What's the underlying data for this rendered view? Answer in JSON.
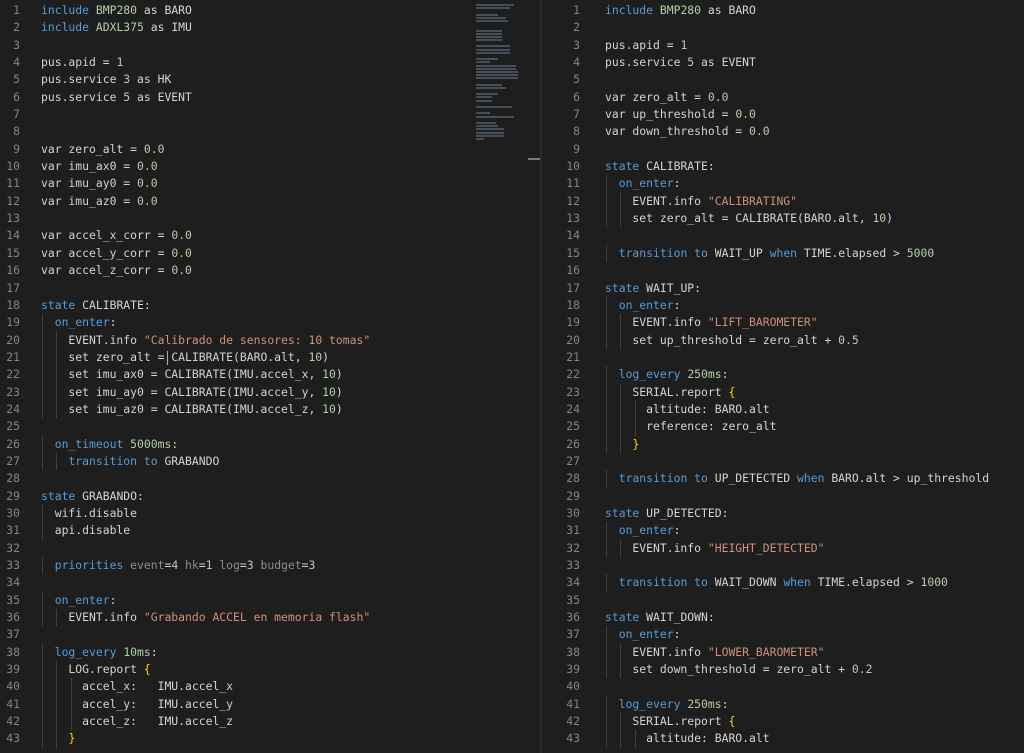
{
  "editor": {
    "left": {
      "lines": [
        {
          "n": "1",
          "html": "<span class='kw'>include</span> <span class='num'>BMP280</span> as BARO"
        },
        {
          "n": "2",
          "html": "<span class='kw'>include</span> <span class='num'>ADXL375</span> as IMU"
        },
        {
          "n": "3",
          "html": ""
        },
        {
          "n": "4",
          "html": "pus.apid = <span class='num'>1</span>"
        },
        {
          "n": "5",
          "html": "pus.service <span class='num'>3</span> as HK"
        },
        {
          "n": "6",
          "html": "pus.service <span class='num'>5</span> as EVENT"
        },
        {
          "n": "7",
          "html": ""
        },
        {
          "n": "8",
          "html": ""
        },
        {
          "n": "9",
          "html": "var zero_alt = <span class='num'>0.0</span>"
        },
        {
          "n": "10",
          "html": "var imu_ax0 = <span class='num'>0.0</span>"
        },
        {
          "n": "11",
          "html": "var imu_ay0 = <span class='num'>0.0</span>"
        },
        {
          "n": "12",
          "html": "var imu_az0 = <span class='num'>0.0</span>"
        },
        {
          "n": "13",
          "html": ""
        },
        {
          "n": "14",
          "html": "var accel_x_corr = <span class='num'>0.0</span>"
        },
        {
          "n": "15",
          "html": "var accel_y_corr = <span class='num'>0.0</span>"
        },
        {
          "n": "16",
          "html": "var accel_z_corr = <span class='num'>0.0</span>"
        },
        {
          "n": "17",
          "html": ""
        },
        {
          "n": "18",
          "html": "<span class='kw'>state</span> CALIBRATE:"
        },
        {
          "n": "19",
          "html": "  <span class='kw'>on_enter</span>:"
        },
        {
          "n": "20",
          "html": "    EVENT.info <span class='str'>\"Calibrado de sensores: 10 tomas\"</span>"
        },
        {
          "n": "21",
          "html": "    set zero_alt = CALIBRATE(BARO.alt, <span class='num'>10</span>)",
          "cursor": true
        },
        {
          "n": "22",
          "html": "    set imu_ax0 = CALIBRATE(IMU.accel_x, <span class='num'>10</span>)"
        },
        {
          "n": "23",
          "html": "    set imu_ay0 = CALIBRATE(IMU.accel_y, <span class='num'>10</span>)"
        },
        {
          "n": "24",
          "html": "    set imu_az0 = CALIBRATE(IMU.accel_z, <span class='num'>10</span>)"
        },
        {
          "n": "25",
          "html": ""
        },
        {
          "n": "26",
          "html": "  <span class='kw'>on_timeout</span> <span class='num'>5000ms</span>:"
        },
        {
          "n": "27",
          "html": "    <span class='kw'>transition</span> <span class='kw'>to</span> GRABANDO"
        },
        {
          "n": "28",
          "html": ""
        },
        {
          "n": "29",
          "html": "<span class='kw'>state</span> GRABANDO:"
        },
        {
          "n": "30",
          "html": "  wifi.disable"
        },
        {
          "n": "31",
          "html": "  api.disable"
        },
        {
          "n": "32",
          "html": ""
        },
        {
          "n": "33",
          "html": "  <span class='kw'>priorities</span> <span class='dim'>event</span>=<span class='num'>4</span> <span class='dim'>hk</span>=<span class='num'>1</span> <span class='dim'>log</span>=<span class='num'>3</span> <span class='dim'>budget</span>=<span class='num'>3</span>"
        },
        {
          "n": "34",
          "html": ""
        },
        {
          "n": "35",
          "html": "  <span class='kw'>on_enter</span>:"
        },
        {
          "n": "36",
          "html": "    EVENT.info <span class='str'>\"Grabando ACCEL en memoria flash\"</span>"
        },
        {
          "n": "37",
          "html": ""
        },
        {
          "n": "38",
          "html": "  <span class='kw'>log_every</span> <span class='num'>10ms</span>:"
        },
        {
          "n": "39",
          "html": "    LOG.report <span class='brace'>{</span>"
        },
        {
          "n": "40",
          "html": "      accel_x:   IMU.accel_x"
        },
        {
          "n": "41",
          "html": "      accel_y:   IMU.accel_y"
        },
        {
          "n": "42",
          "html": "      accel_z:   IMU.accel_z"
        },
        {
          "n": "43",
          "html": "    <span class='brace'>}</span>"
        }
      ]
    },
    "right": {
      "lines": [
        {
          "n": "1",
          "html": "<span class='kw'>include</span> <span class='num'>BMP280</span> as BARO"
        },
        {
          "n": "2",
          "html": ""
        },
        {
          "n": "3",
          "html": "pus.apid = <span class='num'>1</span>"
        },
        {
          "n": "4",
          "html": "pus.service <span class='num'>5</span> as EVENT"
        },
        {
          "n": "5",
          "html": ""
        },
        {
          "n": "6",
          "html": "var zero_alt = <span class='num'>0.0</span>"
        },
        {
          "n": "7",
          "html": "var up_threshold = <span class='num'>0.0</span>"
        },
        {
          "n": "8",
          "html": "var down_threshold = <span class='num'>0.0</span>"
        },
        {
          "n": "9",
          "html": ""
        },
        {
          "n": "10",
          "html": "<span class='kw'>state</span> CALIBRATE:"
        },
        {
          "n": "11",
          "html": "  <span class='kw'>on_enter</span>:"
        },
        {
          "n": "12",
          "html": "    EVENT.info <span class='str'>\"CALIBRATING\"</span>"
        },
        {
          "n": "13",
          "html": "    set zero_alt = CALIBRATE(BARO.alt, <span class='num'>10</span>)"
        },
        {
          "n": "14",
          "html": ""
        },
        {
          "n": "15",
          "html": "  <span class='kw'>transition</span> <span class='kw'>to</span> WAIT_UP <span class='kw'>when</span> TIME.elapsed &gt; <span class='num'>5000</span>"
        },
        {
          "n": "16",
          "html": ""
        },
        {
          "n": "17",
          "html": "<span class='kw'>state</span> WAIT_UP:"
        },
        {
          "n": "18",
          "html": "  <span class='kw'>on_enter</span>:"
        },
        {
          "n": "19",
          "html": "    EVENT.info <span class='str'>\"LIFT_BAROMETER\"</span>"
        },
        {
          "n": "20",
          "html": "    set up_threshold = zero_alt + <span class='num'>0.5</span>"
        },
        {
          "n": "21",
          "html": ""
        },
        {
          "n": "22",
          "html": "  <span class='kw'>log_every</span> <span class='num'>250ms</span>:"
        },
        {
          "n": "23",
          "html": "    SERIAL.report <span class='brace'>{</span>"
        },
        {
          "n": "24",
          "html": "      altitude: BARO.alt"
        },
        {
          "n": "25",
          "html": "      reference: zero_alt"
        },
        {
          "n": "26",
          "html": "    <span class='brace'>}</span>"
        },
        {
          "n": "27",
          "html": ""
        },
        {
          "n": "28",
          "html": "  <span class='kw'>transition</span> <span class='kw'>to</span> UP_DETECTED <span class='kw'>when</span> BARO.alt &gt; up_threshold"
        },
        {
          "n": "29",
          "html": ""
        },
        {
          "n": "30",
          "html": "<span class='kw'>state</span> UP_DETECTED:"
        },
        {
          "n": "31",
          "html": "  <span class='kw'>on_enter</span>:"
        },
        {
          "n": "32",
          "html": "    EVENT.info <span class='str'>\"HEIGHT_DETECTED\"</span>"
        },
        {
          "n": "33",
          "html": ""
        },
        {
          "n": "34",
          "html": "  <span class='kw'>transition</span> <span class='kw'>to</span> WAIT_DOWN <span class='kw'>when</span> TIME.elapsed &gt; <span class='num'>1000</span>"
        },
        {
          "n": "35",
          "html": ""
        },
        {
          "n": "36",
          "html": "<span class='kw'>state</span> WAIT_DOWN:"
        },
        {
          "n": "37",
          "html": "  <span class='kw'>on_enter</span>:"
        },
        {
          "n": "38",
          "html": "    EVENT.info <span class='str'>\"LOWER_BAROMETER\"</span>"
        },
        {
          "n": "39",
          "html": "    set down_threshold = zero_alt + <span class='num'>0.2</span>"
        },
        {
          "n": "40",
          "html": ""
        },
        {
          "n": "41",
          "html": "  <span class='kw'>log_every</span> <span class='num'>250ms</span>:"
        },
        {
          "n": "42",
          "html": "    SERIAL.report <span class='brace'>{</span>"
        },
        {
          "n": "43",
          "html": "      altitude: BARO.alt"
        }
      ]
    }
  }
}
